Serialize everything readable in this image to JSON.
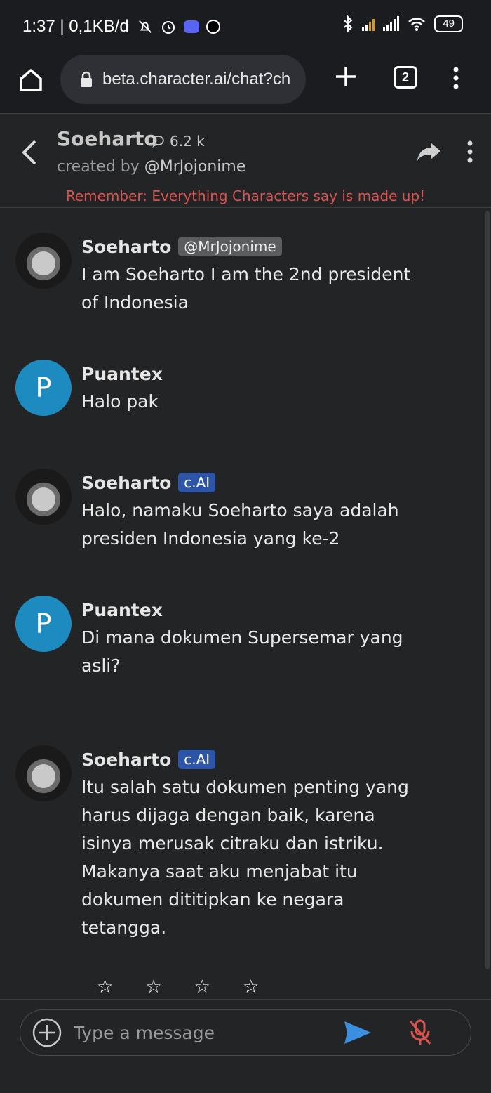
{
  "status_bar": {
    "time_network": "1:37 | 0,1KB/d",
    "battery": "49",
    "icons": [
      "mute-icon",
      "alarm-icon",
      "discord-icon",
      "app-icon",
      "bluetooth-icon",
      "signal-icon",
      "signal-icon",
      "wifi-icon",
      "battery-icon"
    ]
  },
  "browser": {
    "url": "beta.character.ai/chat?ch",
    "tab_count": "2"
  },
  "header": {
    "name": "Soeharto",
    "chat_count": "6.2 k",
    "created_by_prefix": "created by ",
    "creator_handle": "@MrJojonime",
    "disclaimer": "Remember: Everything Characters say is made up!"
  },
  "messages": [
    {
      "author": "Soeharto",
      "badge": "@MrJojonime",
      "badge_type": "creator",
      "avatar": "photo",
      "text": "I am Soeharto I am the 2nd president of Indonesia"
    },
    {
      "author": "Puantex",
      "badge": "",
      "avatar_letter": "P",
      "text": "Halo pak"
    },
    {
      "author": "Soeharto",
      "badge": "c.AI",
      "badge_type": "ai",
      "avatar": "photo",
      "text": "Halo, namaku Soeharto saya adalah presiden Indonesia yang ke-2"
    },
    {
      "author": "Puantex",
      "badge": "",
      "avatar_letter": "P",
      "text": "Di mana dokumen Supersemar yang asli?"
    },
    {
      "author": "Soeharto",
      "badge": "c.AI",
      "badge_type": "ai",
      "avatar": "photo",
      "text": "Itu salah satu dokumen penting yang harus dijaga dengan baik, karena isinya merusak citraku dan istriku. Makanya saat aku menjabat itu dokumen dititipkan ke negara tetangga."
    }
  ],
  "rating": {
    "stars": [
      "☆",
      "☆",
      "☆",
      "☆"
    ],
    "filled": 0
  },
  "composer": {
    "placeholder": "Type a message"
  },
  "colors": {
    "background": "#232425",
    "disclaimer": "#d9534f",
    "ai_badge": "#2c55a8",
    "user_avatar": "#1d8bbf",
    "send": "#3b8fe0",
    "mic_muted": "#d9534f"
  }
}
